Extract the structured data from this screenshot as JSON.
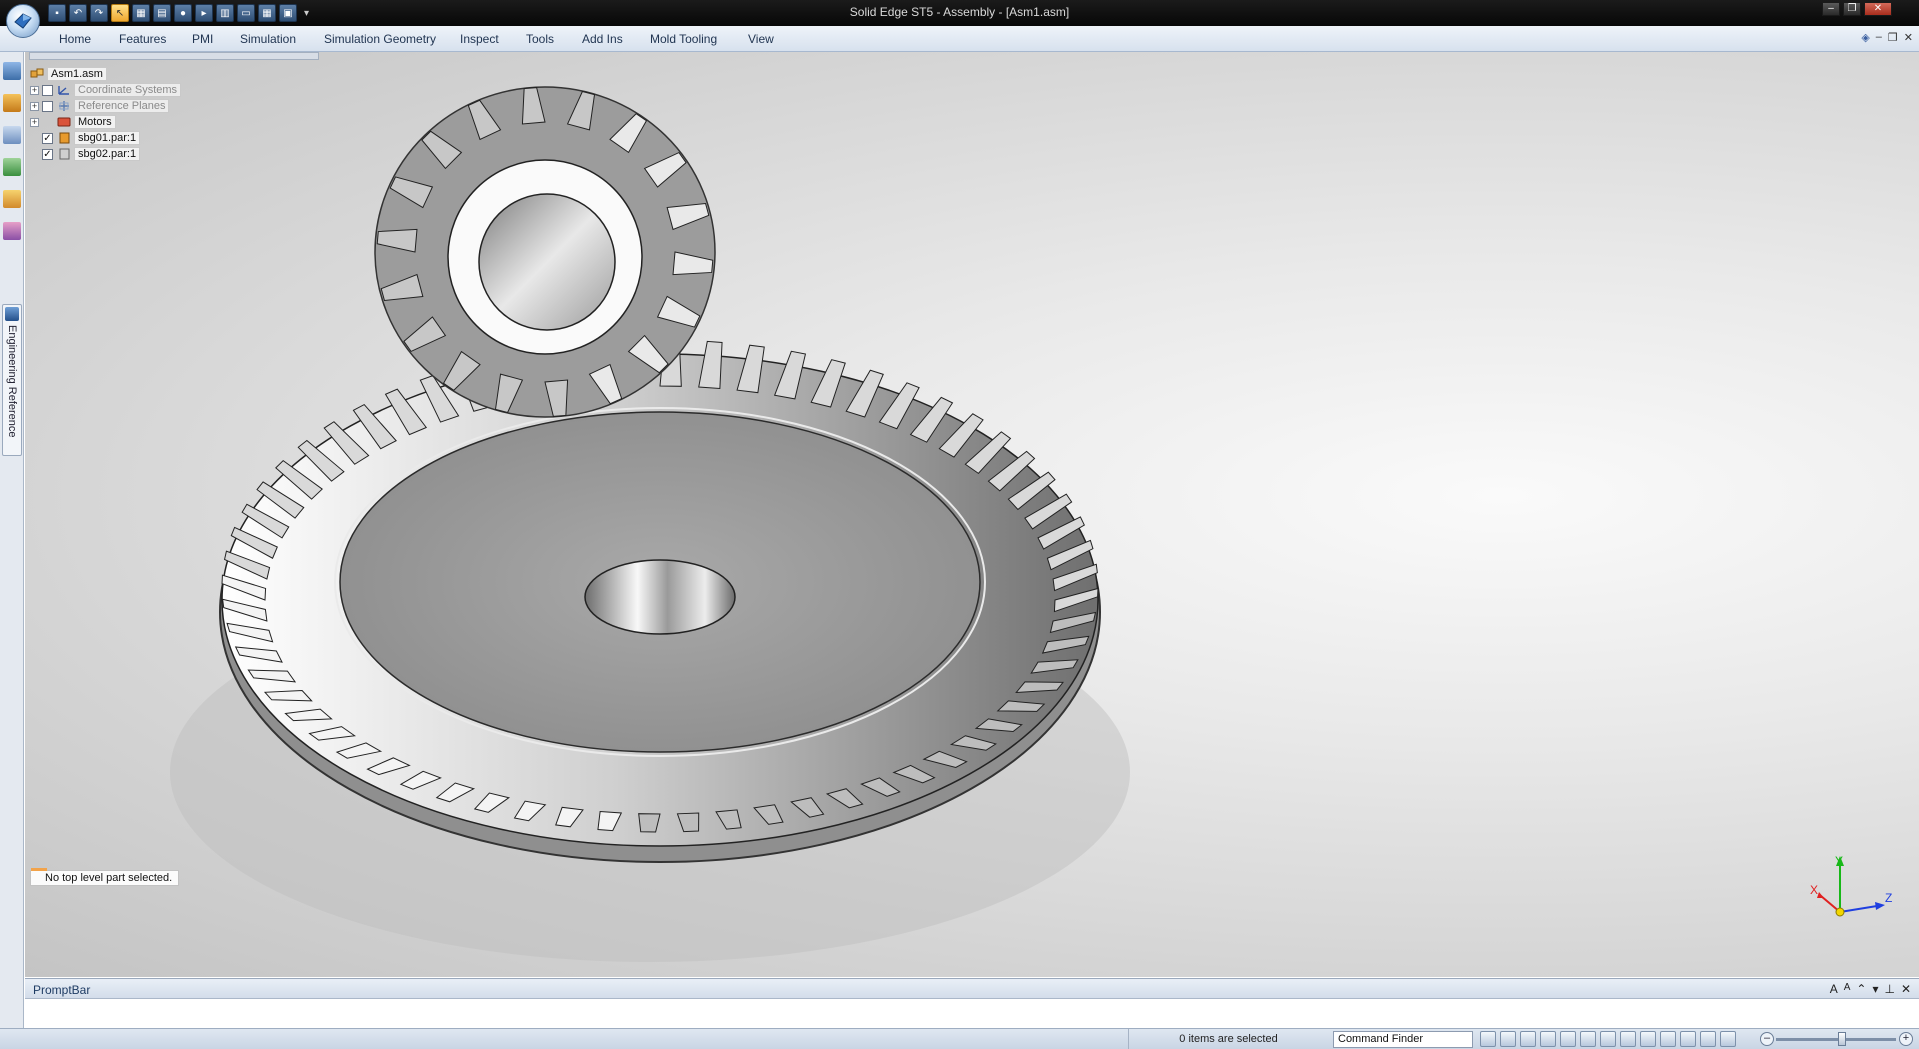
{
  "window": {
    "title": "Solid Edge ST5 - Assembly - [Asm1.asm]"
  },
  "ribbon": {
    "tabs": [
      {
        "label": "Home"
      },
      {
        "label": "Features"
      },
      {
        "label": "PMI"
      },
      {
        "label": "Simulation"
      },
      {
        "label": "Simulation Geometry"
      },
      {
        "label": "Inspect"
      },
      {
        "label": "Tools"
      },
      {
        "label": "Add Ins"
      },
      {
        "label": "Mold Tooling"
      },
      {
        "label": "View"
      }
    ]
  },
  "leftbar": {
    "engineering_reference_label": "Engineering Reference"
  },
  "pathfinder": {
    "root": "Asm1.asm",
    "items": [
      {
        "label": "Coordinate Systems",
        "checked": false
      },
      {
        "label": "Reference Planes",
        "checked": false
      },
      {
        "label": "Motors"
      },
      {
        "label": "sbg01.par:1",
        "checked": true
      },
      {
        "label": "sbg02.par:1",
        "checked": true
      }
    ],
    "checkmark": "✓",
    "status_note": "No top level part selected."
  },
  "triad": {
    "x_label": "X",
    "y_label": "Y",
    "z_label": "Z"
  },
  "promptbar": {
    "title": "PromptBar"
  },
  "statusbar": {
    "selection_text": "0 items are selected",
    "command_finder_value": "Command Finder"
  },
  "colors": {
    "ribbon_accent": "#d7e1ee",
    "titlebar": "#0b0b0b",
    "x_axis": "#e02020",
    "y_axis": "#18b818",
    "z_axis": "#1f3fe0",
    "origin": "#f2d600"
  }
}
